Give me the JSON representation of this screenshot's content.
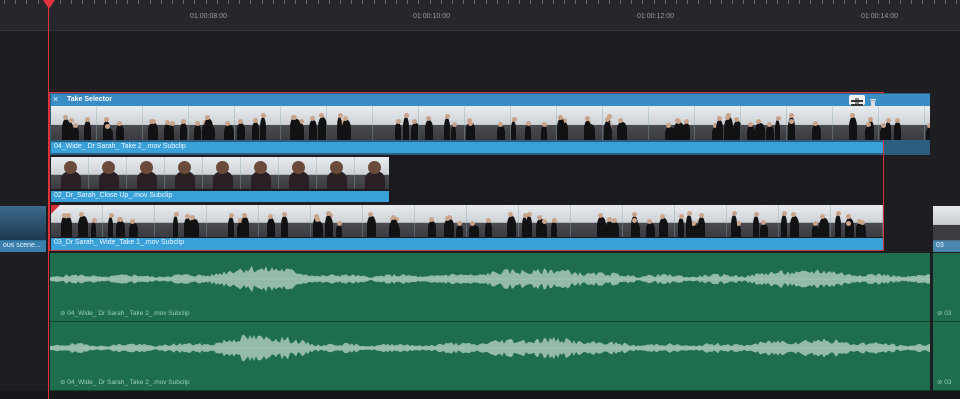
{
  "ruler": {
    "timecodes": [
      "01:00:08:00",
      "01:00:10:00",
      "01:00:12:00",
      "01:00:14:00"
    ]
  },
  "take_selector": {
    "title": "Take Selector",
    "close_icon": "close-x",
    "takes_icon": "take-selector-icon",
    "trash_icon": "trash-icon"
  },
  "clips": {
    "wide_take2": "04_Wide_ Dr Sarah_ Take 2_.mov Subclip",
    "closeup": "02_Dr_Sarah_Close Up_.mov Subclip",
    "wide_take1": "03_Dr Sarah_ Wide_Take 1_.mov Subclip",
    "left_clip": "ous scene...",
    "right_clip": "03",
    "right_audio_1": "03",
    "right_audio_2": "03"
  },
  "audio": {
    "track1_label": "04_Wide_ Dr Sarah_ Take 2_.mov Subclip",
    "track2_label": "04_Wide_ Dr Sarah_ Take 2_.mov Subclip",
    "link_icon": "link-icon"
  },
  "colors": {
    "clip_blue": "#3aa0d8",
    "audio_green": "#1e6e4e",
    "selector_red": "#d0343a",
    "playhead": "#e0343a"
  }
}
